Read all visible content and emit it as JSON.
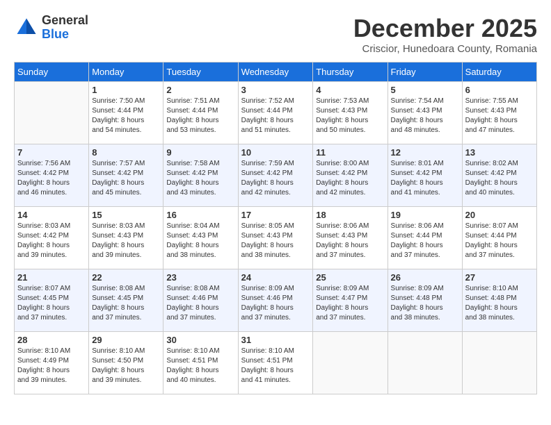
{
  "header": {
    "logo": {
      "general": "General",
      "blue": "Blue"
    },
    "title": "December 2025",
    "subtitle": "Criscior, Hunedoara County, Romania"
  },
  "calendar": {
    "days_of_week": [
      "Sunday",
      "Monday",
      "Tuesday",
      "Wednesday",
      "Thursday",
      "Friday",
      "Saturday"
    ],
    "weeks": [
      [
        {
          "day": "",
          "info": ""
        },
        {
          "day": "1",
          "info": "Sunrise: 7:50 AM\nSunset: 4:44 PM\nDaylight: 8 hours\nand 54 minutes."
        },
        {
          "day": "2",
          "info": "Sunrise: 7:51 AM\nSunset: 4:44 PM\nDaylight: 8 hours\nand 53 minutes."
        },
        {
          "day": "3",
          "info": "Sunrise: 7:52 AM\nSunset: 4:44 PM\nDaylight: 8 hours\nand 51 minutes."
        },
        {
          "day": "4",
          "info": "Sunrise: 7:53 AM\nSunset: 4:43 PM\nDaylight: 8 hours\nand 50 minutes."
        },
        {
          "day": "5",
          "info": "Sunrise: 7:54 AM\nSunset: 4:43 PM\nDaylight: 8 hours\nand 48 minutes."
        },
        {
          "day": "6",
          "info": "Sunrise: 7:55 AM\nSunset: 4:43 PM\nDaylight: 8 hours\nand 47 minutes."
        }
      ],
      [
        {
          "day": "7",
          "info": "Sunrise: 7:56 AM\nSunset: 4:42 PM\nDaylight: 8 hours\nand 46 minutes."
        },
        {
          "day": "8",
          "info": "Sunrise: 7:57 AM\nSunset: 4:42 PM\nDaylight: 8 hours\nand 45 minutes."
        },
        {
          "day": "9",
          "info": "Sunrise: 7:58 AM\nSunset: 4:42 PM\nDaylight: 8 hours\nand 43 minutes."
        },
        {
          "day": "10",
          "info": "Sunrise: 7:59 AM\nSunset: 4:42 PM\nDaylight: 8 hours\nand 42 minutes."
        },
        {
          "day": "11",
          "info": "Sunrise: 8:00 AM\nSunset: 4:42 PM\nDaylight: 8 hours\nand 42 minutes."
        },
        {
          "day": "12",
          "info": "Sunrise: 8:01 AM\nSunset: 4:42 PM\nDaylight: 8 hours\nand 41 minutes."
        },
        {
          "day": "13",
          "info": "Sunrise: 8:02 AM\nSunset: 4:42 PM\nDaylight: 8 hours\nand 40 minutes."
        }
      ],
      [
        {
          "day": "14",
          "info": "Sunrise: 8:03 AM\nSunset: 4:42 PM\nDaylight: 8 hours\nand 39 minutes."
        },
        {
          "day": "15",
          "info": "Sunrise: 8:03 AM\nSunset: 4:43 PM\nDaylight: 8 hours\nand 39 minutes."
        },
        {
          "day": "16",
          "info": "Sunrise: 8:04 AM\nSunset: 4:43 PM\nDaylight: 8 hours\nand 38 minutes."
        },
        {
          "day": "17",
          "info": "Sunrise: 8:05 AM\nSunset: 4:43 PM\nDaylight: 8 hours\nand 38 minutes."
        },
        {
          "day": "18",
          "info": "Sunrise: 8:06 AM\nSunset: 4:43 PM\nDaylight: 8 hours\nand 37 minutes."
        },
        {
          "day": "19",
          "info": "Sunrise: 8:06 AM\nSunset: 4:44 PM\nDaylight: 8 hours\nand 37 minutes."
        },
        {
          "day": "20",
          "info": "Sunrise: 8:07 AM\nSunset: 4:44 PM\nDaylight: 8 hours\nand 37 minutes."
        }
      ],
      [
        {
          "day": "21",
          "info": "Sunrise: 8:07 AM\nSunset: 4:45 PM\nDaylight: 8 hours\nand 37 minutes."
        },
        {
          "day": "22",
          "info": "Sunrise: 8:08 AM\nSunset: 4:45 PM\nDaylight: 8 hours\nand 37 minutes."
        },
        {
          "day": "23",
          "info": "Sunrise: 8:08 AM\nSunset: 4:46 PM\nDaylight: 8 hours\nand 37 minutes."
        },
        {
          "day": "24",
          "info": "Sunrise: 8:09 AM\nSunset: 4:46 PM\nDaylight: 8 hours\nand 37 minutes."
        },
        {
          "day": "25",
          "info": "Sunrise: 8:09 AM\nSunset: 4:47 PM\nDaylight: 8 hours\nand 37 minutes."
        },
        {
          "day": "26",
          "info": "Sunrise: 8:09 AM\nSunset: 4:48 PM\nDaylight: 8 hours\nand 38 minutes."
        },
        {
          "day": "27",
          "info": "Sunrise: 8:10 AM\nSunset: 4:48 PM\nDaylight: 8 hours\nand 38 minutes."
        }
      ],
      [
        {
          "day": "28",
          "info": "Sunrise: 8:10 AM\nSunset: 4:49 PM\nDaylight: 8 hours\nand 39 minutes."
        },
        {
          "day": "29",
          "info": "Sunrise: 8:10 AM\nSunset: 4:50 PM\nDaylight: 8 hours\nand 39 minutes."
        },
        {
          "day": "30",
          "info": "Sunrise: 8:10 AM\nSunset: 4:51 PM\nDaylight: 8 hours\nand 40 minutes."
        },
        {
          "day": "31",
          "info": "Sunrise: 8:10 AM\nSunset: 4:51 PM\nDaylight: 8 hours\nand 41 minutes."
        },
        {
          "day": "",
          "info": ""
        },
        {
          "day": "",
          "info": ""
        },
        {
          "day": "",
          "info": ""
        }
      ]
    ]
  }
}
